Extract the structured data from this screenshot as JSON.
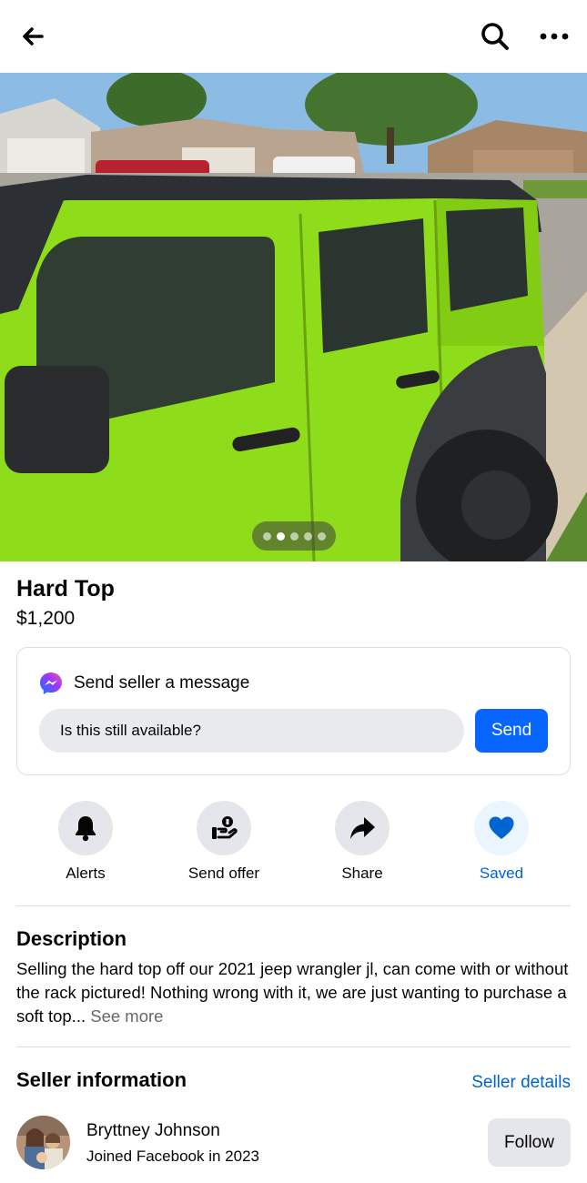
{
  "header": {
    "back_icon": "arrow-left-icon",
    "search_icon": "search-icon",
    "more_icon": "more-horizontal-icon"
  },
  "photo": {
    "total_images": 5,
    "active_image": 2
  },
  "listing": {
    "title": "Hard Top",
    "price": "$1,200"
  },
  "message": {
    "heading": "Send seller a message",
    "input_value": "Is this still available?",
    "send_label": "Send"
  },
  "actions": [
    {
      "label": "Alerts",
      "icon": "bell-icon"
    },
    {
      "label": "Send offer",
      "icon": "offer-hand-icon"
    },
    {
      "label": "Share",
      "icon": "share-arrow-icon"
    },
    {
      "label": "Saved",
      "icon": "heart-icon"
    }
  ],
  "description": {
    "heading": "Description",
    "text": "Selling the hard top off our 2021 jeep wrangler jl, can come with or without the rack pictured! Nothing wrong with it, we are just wanting to purchase a soft top...",
    "see_more": "See more"
  },
  "seller": {
    "heading": "Seller information",
    "details_link": "Seller details",
    "name": "Bryttney Johnson",
    "joined": "Joined Facebook in 2023",
    "follow_label": "Follow"
  },
  "colors": {
    "accent": "#0866ff",
    "link": "#0064d1",
    "jeep_body": "#8fdc1a"
  }
}
